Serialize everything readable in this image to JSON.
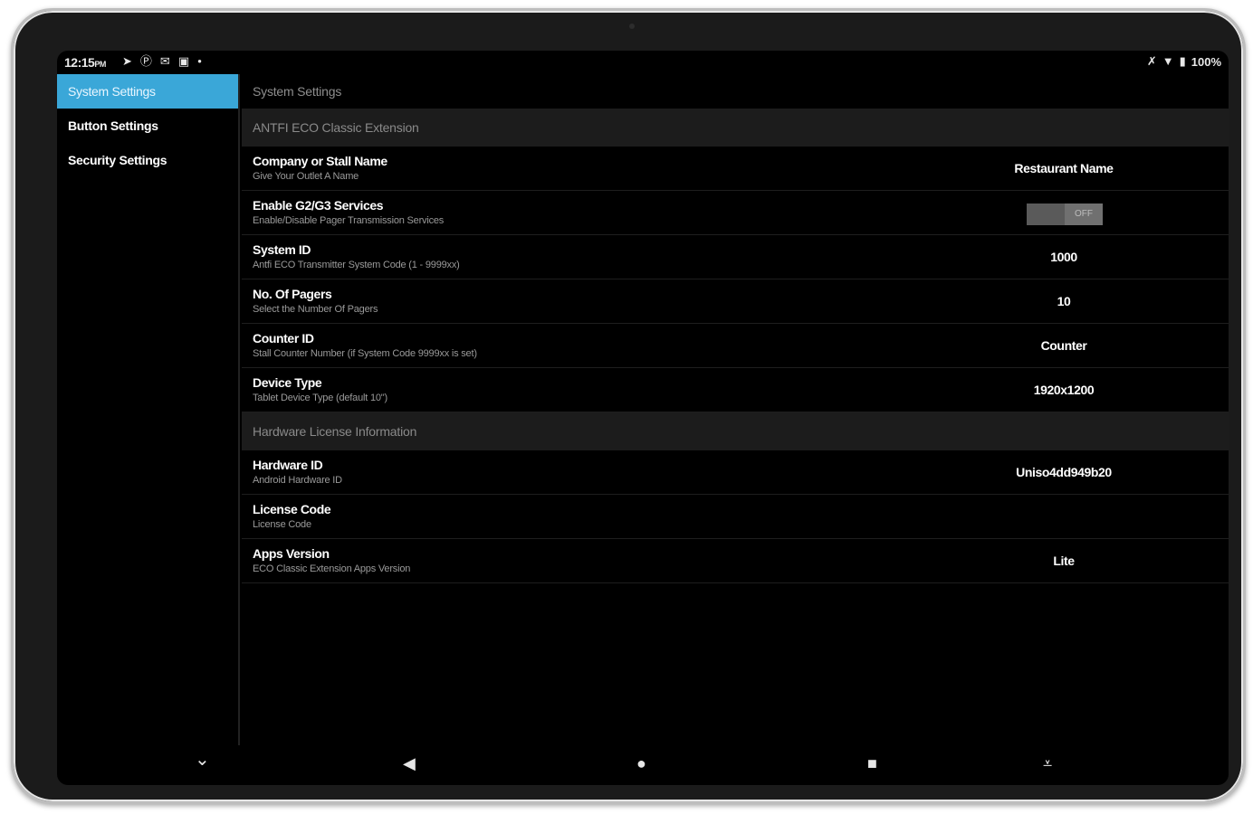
{
  "status": {
    "time": "12:15",
    "ampm": "PM",
    "left_icons": [
      "telegram-icon",
      "p-app-icon",
      "mail-icon",
      "gallery-icon",
      "dot-icon"
    ],
    "battery": "100%",
    "right_icons": [
      "mute-icon",
      "wifi-icon",
      "battery-icon"
    ]
  },
  "sidebar": {
    "items": [
      {
        "label": "System Settings",
        "active": true
      },
      {
        "label": "Button Settings",
        "active": false
      },
      {
        "label": "Security Settings",
        "active": false
      }
    ]
  },
  "main": {
    "title": "System Settings",
    "sections": [
      {
        "header": "ANTFI ECO Classic Extension",
        "rows": [
          {
            "label": "Company or Stall Name",
            "sub": "Give Your Outlet A Name",
            "value": "Restaurant Name"
          },
          {
            "label": "Enable G2/G3 Services",
            "sub": "Enable/Disable Pager Transmission Services",
            "toggle": "OFF"
          },
          {
            "label": "System ID",
            "sub": "Antfi ECO Transmitter System Code (1 - 9999xx)",
            "value": "1000"
          },
          {
            "label": "No. Of Pagers",
            "sub": "Select the Number Of Pagers",
            "value": "10"
          },
          {
            "label": "Counter ID",
            "sub": "Stall Counter Number (if System Code 9999xx is set)",
            "value": "Counter"
          },
          {
            "label": "Device Type",
            "sub": "Tablet Device Type (default 10\")",
            "value": "1920x1200"
          }
        ]
      },
      {
        "header": "Hardware License Information",
        "rows": [
          {
            "label": "Hardware ID",
            "sub": "Android Hardware ID",
            "value": "Uniso4dd949b20"
          },
          {
            "label": "License Code",
            "sub": "License Code",
            "value": ""
          },
          {
            "label": "Apps Version",
            "sub": "ECO Classic Extension Apps Version",
            "value": "Lite"
          }
        ]
      }
    ]
  },
  "navbar": {
    "icons": [
      "chevron-down-icon",
      "back-icon",
      "home-icon",
      "recents-icon",
      "keyboard-hide-icon"
    ],
    "glyphs": {
      "down": "⌄",
      "back": "◀",
      "home": "●",
      "recents": "■",
      "kb": "⩡"
    }
  },
  "colors": {
    "accent": "#3aa7d8",
    "background": "#000000",
    "section_header": "#1c1c1c"
  }
}
